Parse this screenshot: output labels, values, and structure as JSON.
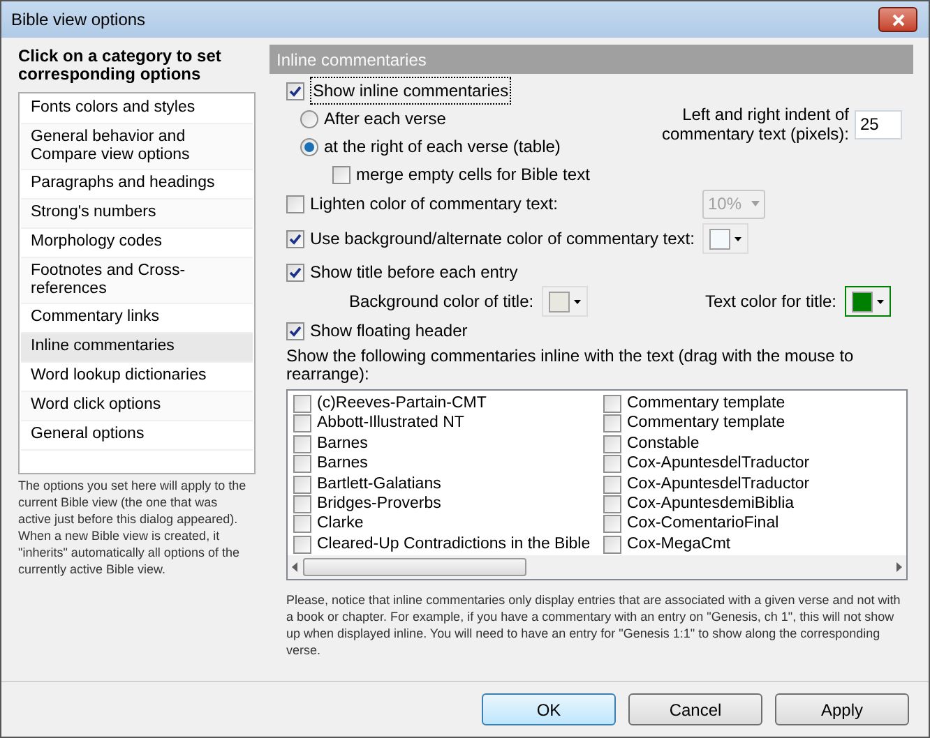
{
  "window": {
    "title": "Bible view options"
  },
  "sidebar": {
    "heading": "Click on a category to set corresponding options",
    "items": [
      {
        "label": "Fonts colors and styles",
        "selected": false
      },
      {
        "label": "General behavior and Compare view options",
        "selected": false
      },
      {
        "label": "Paragraphs and headings",
        "selected": false
      },
      {
        "label": "Strong's numbers",
        "selected": false
      },
      {
        "label": "Morphology codes",
        "selected": false
      },
      {
        "label": "Footnotes and Cross-references",
        "selected": false
      },
      {
        "label": "Commentary links",
        "selected": false
      },
      {
        "label": "Inline commentaries",
        "selected": true
      },
      {
        "label": "Word lookup dictionaries",
        "selected": false
      },
      {
        "label": "Word click options",
        "selected": false
      },
      {
        "label": "General options",
        "selected": false
      }
    ],
    "note": "The options you set here will apply to the current Bible view (the one that was active just before this dialog appeared). When a new Bible view is created, it \"inherits\" automatically all options of the currently active Bible view."
  },
  "panel": {
    "title": "Inline commentaries",
    "show_inline": {
      "label": "Show inline commentaries",
      "checked": true
    },
    "placement": [
      {
        "label": "After each verse",
        "selected": false
      },
      {
        "label": "at the right of each verse (table)",
        "selected": true
      }
    ],
    "merge_cells": {
      "label": "merge empty cells for Bible text",
      "checked": false
    },
    "indent": {
      "label": "Left and right indent of commentary text (pixels):",
      "value": "25"
    },
    "lighten": {
      "label": "Lighten color of commentary text:",
      "checked": false,
      "value": "10%",
      "disabled": true
    },
    "use_background": {
      "label": "Use background/alternate color of commentary text:",
      "checked": true,
      "color": "#f4f9fc"
    },
    "show_title": {
      "label": "Show title before each entry",
      "checked": true
    },
    "title_background": {
      "label": "Background color of title:",
      "color": "#e8e8e0",
      "focused": false
    },
    "title_text_color": {
      "label": "Text color for title:",
      "color": "#008000",
      "focused": true
    },
    "floating_header": {
      "label": "Show floating header",
      "checked": true
    },
    "list_caption": "Show the following commentaries inline with the text (drag with the mouse to rearrange):",
    "commentaries": [
      {
        "label": "(c)Reeves-Partain-CMT",
        "checked": false
      },
      {
        "label": "Abbott-Illustrated NT",
        "checked": false
      },
      {
        "label": "Barnes",
        "checked": false
      },
      {
        "label": "Barnes",
        "checked": false
      },
      {
        "label": "Bartlett-Galatians",
        "checked": false
      },
      {
        "label": "Bridges-Proverbs",
        "checked": false
      },
      {
        "label": "Clarke",
        "checked": false
      },
      {
        "label": "Cleared-Up Contradictions in the Bible",
        "checked": false
      },
      {
        "label": "Commentary template",
        "checked": false
      },
      {
        "label": "Commentary template",
        "checked": false
      },
      {
        "label": "Constable",
        "checked": false
      },
      {
        "label": "Cox-ApuntesdelTraductor",
        "checked": false
      },
      {
        "label": "Cox-ApuntesdelTraductor",
        "checked": false
      },
      {
        "label": "Cox-ApuntesdemiBiblia",
        "checked": false
      },
      {
        "label": "Cox-ComentarioFinal",
        "checked": false
      },
      {
        "label": "Cox-MegaCmt",
        "checked": false
      }
    ],
    "notice": "Please, notice that inline commentaries only display entries that are associated with a given verse and not with a book or chapter. For example, if you have a commentary with an entry on \"Genesis, ch 1\", this will not show up when displayed inline. You will need to have an entry for \"Genesis 1:1\" to show along the corresponding verse."
  },
  "buttons": [
    {
      "label": "OK",
      "default": true
    },
    {
      "label": "Cancel",
      "default": false
    },
    {
      "label": "Apply",
      "default": false
    }
  ]
}
